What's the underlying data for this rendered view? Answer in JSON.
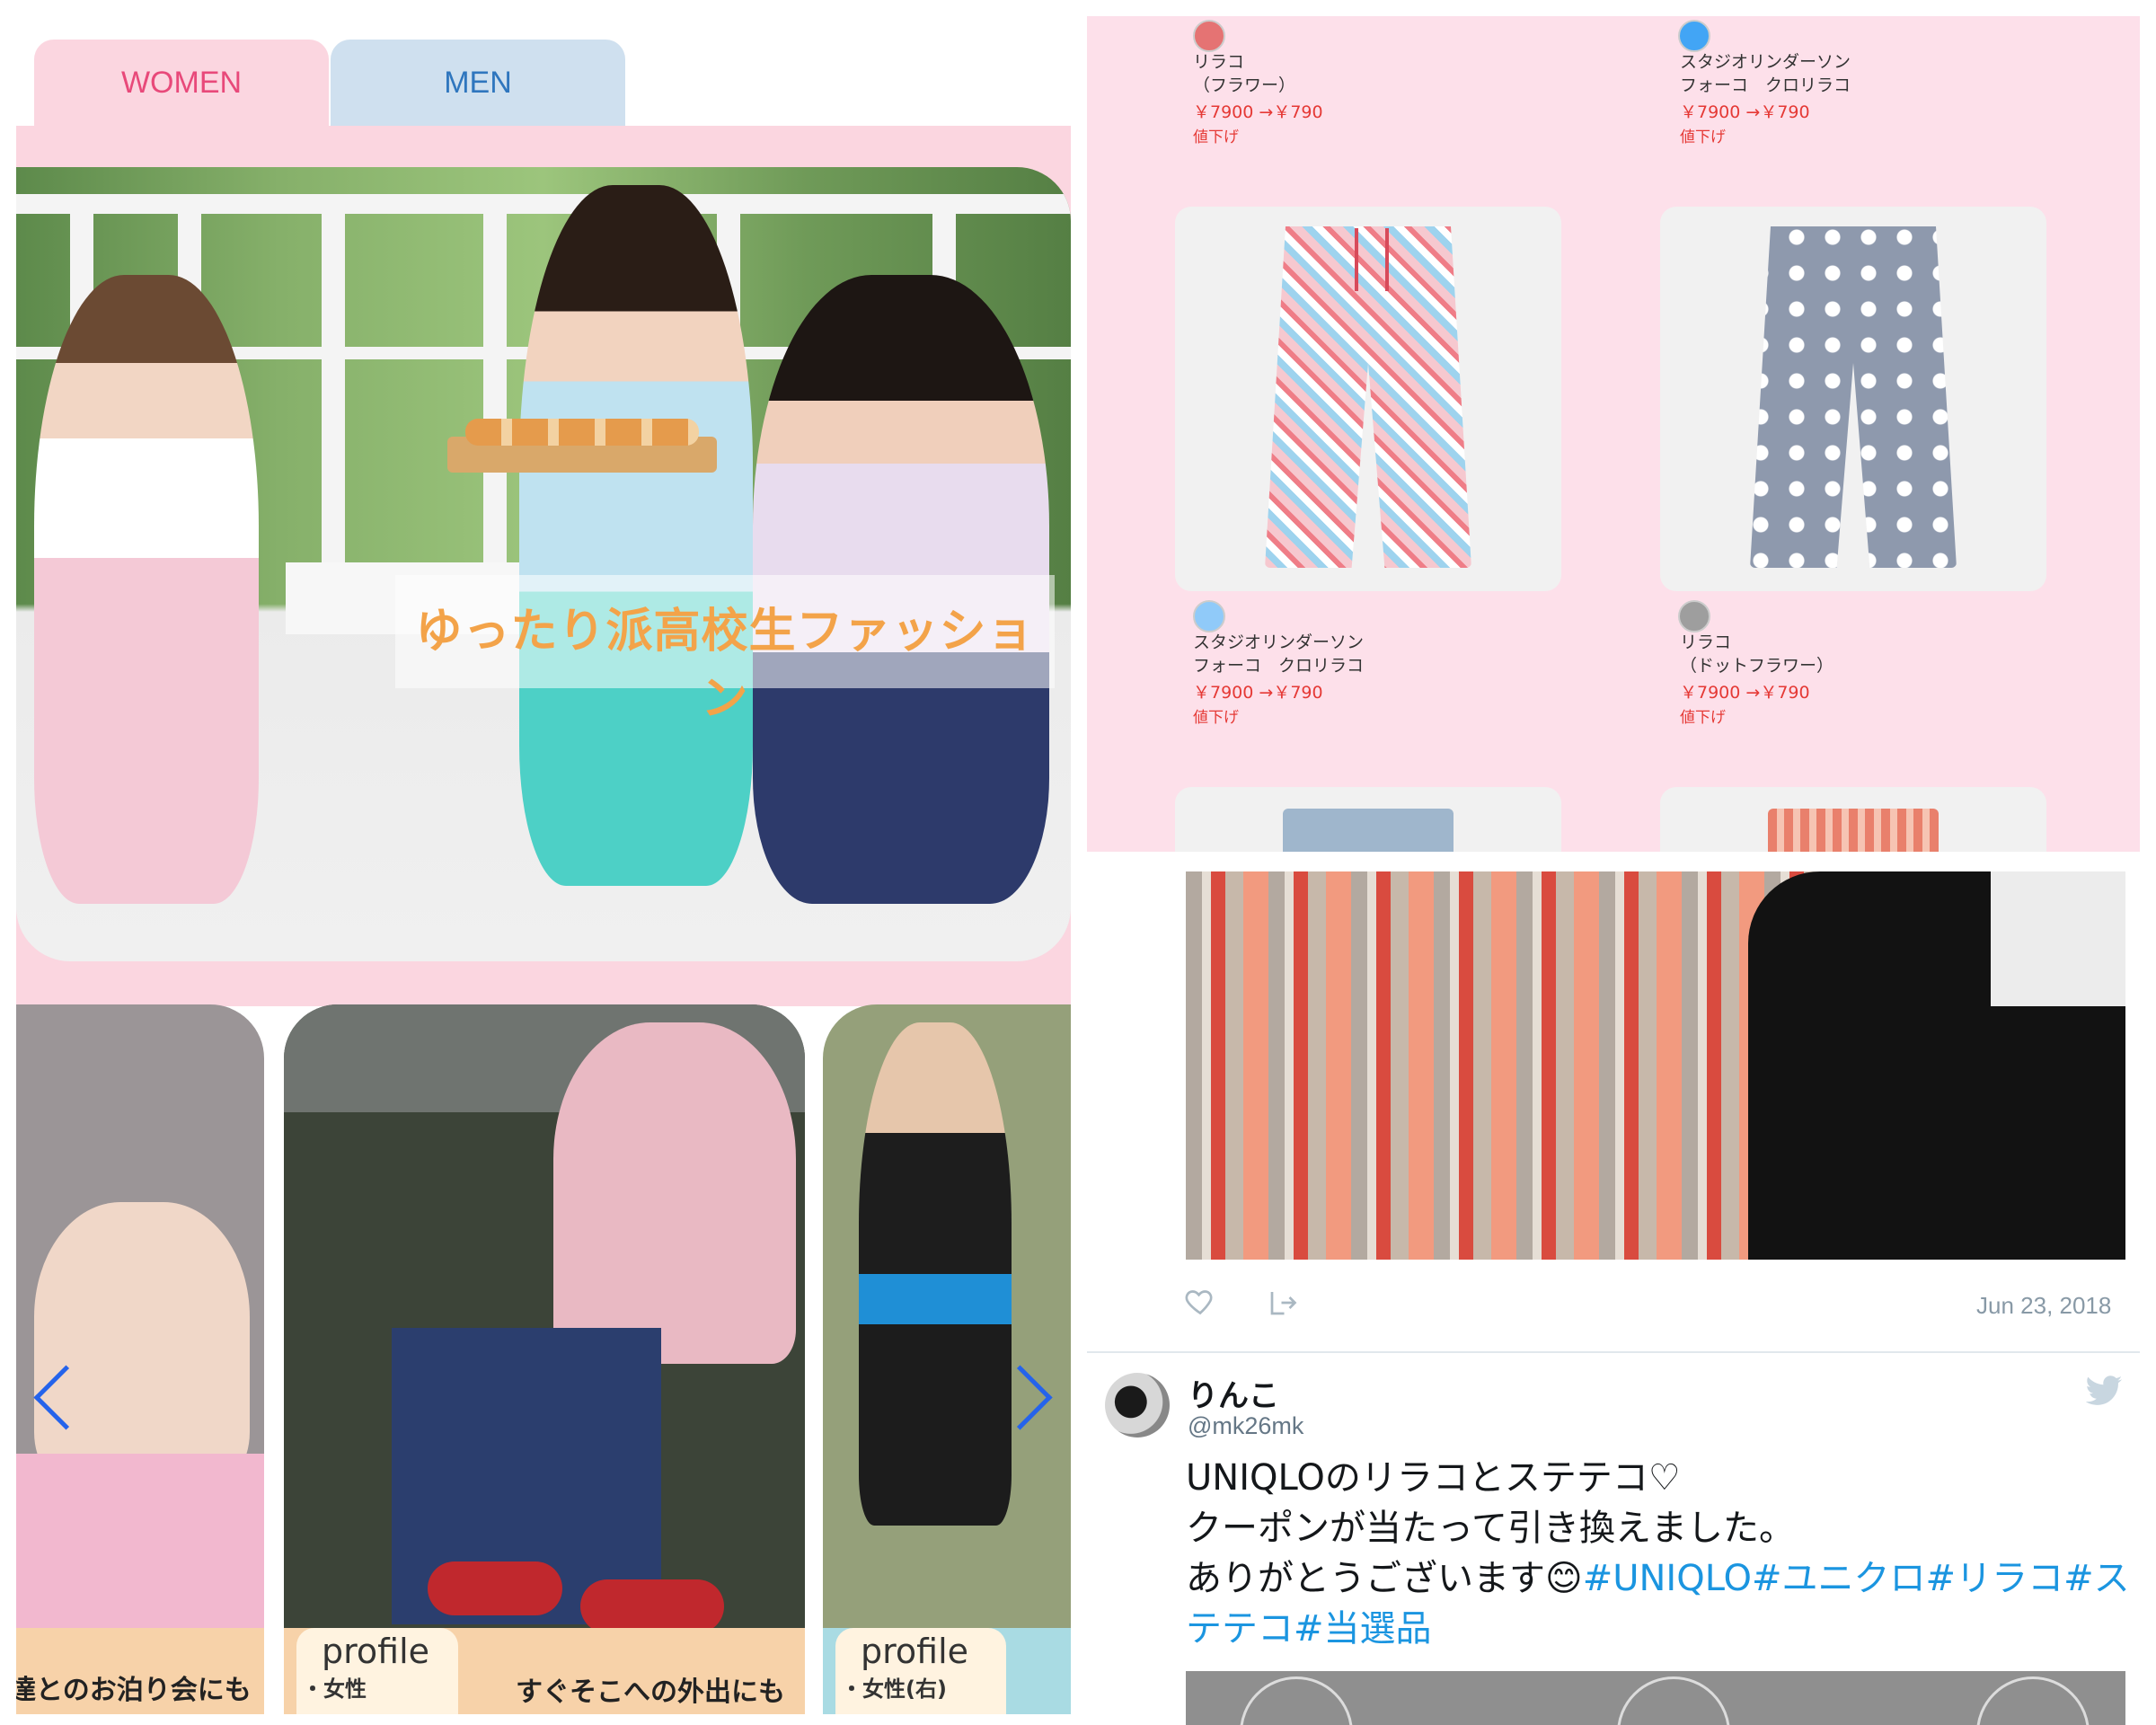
{
  "tabs": {
    "women": "WOMEN",
    "men": "MEN"
  },
  "hero": {
    "caption": "ゆったり派高校生ファッション"
  },
  "cards": [
    {
      "caption": "達とのお泊り会にも"
    },
    {
      "profile_title": "profile",
      "profile_sub": "・女性",
      "caption": "すぐそこへの外出にも"
    },
    {
      "profile_title": "profile",
      "profile_sub": "・女性(右)"
    }
  ],
  "products": [
    {
      "name_line1": "リラコ",
      "name_line2": "（フラワー）",
      "price": "￥7900 →￥790",
      "sale": "値下げ",
      "avatar_color": "#e57373"
    },
    {
      "name_line1": "スタジオリンダーソン",
      "name_line2": "フォーコ　クロリラコ",
      "price": "￥7900 →￥790",
      "sale": "値下げ",
      "avatar_color": "#42a5f5"
    },
    {
      "name_line1": "スタジオリンダーソン",
      "name_line2": "フォーコ　クロリラコ",
      "price": "￥7900 →￥790",
      "sale": "値下げ",
      "avatar_color": "#90caf9"
    },
    {
      "name_line1": "リラコ",
      "name_line2": "（ドットフラワー）",
      "price": "￥7900 →￥790",
      "sale": "値下げ",
      "avatar_color": "#9e9e9e"
    }
  ],
  "tweet1": {
    "date": "Jun 23, 2018"
  },
  "tweet2": {
    "name": "りんこ",
    "handle": "@mk26mk",
    "line1": "UNIQLOのリラコとステテコ♡",
    "line2": "クーポンが当たって引き換えました。",
    "line3_text": "ありがとうございます",
    "emoji": "😊",
    "line3_tags": "#UNIQLO#ユニクロ#リラコ#ス",
    "line4_tags": "テテコ#当選品"
  },
  "colors": {
    "pink_bg": "#fbd6e0",
    "blue_tab": "#cfe0ef",
    "women_text": "#e8497a",
    "men_text": "#2f76be",
    "price_red": "#e53935",
    "hashtag_blue": "#1b95e0"
  },
  "icons": [
    "heart-icon",
    "share-icon",
    "twitter-bird-icon",
    "chevron-left-icon",
    "chevron-right-icon"
  ]
}
